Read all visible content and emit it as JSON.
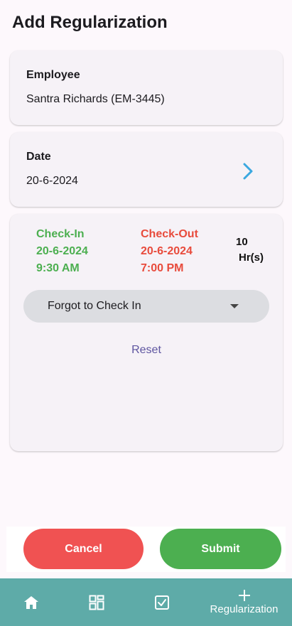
{
  "page": {
    "title": "Add Regularization"
  },
  "employee": {
    "label": "Employee",
    "value": "Santra Richards (EM-3445)"
  },
  "date": {
    "label": "Date",
    "value": "20-6-2024"
  },
  "check_in": {
    "label": "Check-In",
    "date": "20-6-2024",
    "time": "9:30 AM"
  },
  "check_out": {
    "label": "Check-Out",
    "date": "20-6-2024",
    "time": "7:00 PM"
  },
  "duration": {
    "value": "10",
    "unit": "Hr(s)"
  },
  "reason_dropdown": {
    "selected": "Forgot to Check In"
  },
  "reset": {
    "label": "Reset"
  },
  "actions": {
    "cancel": "Cancel",
    "submit": "Submit"
  },
  "nav": {
    "items": [
      {
        "icon": "home-icon"
      },
      {
        "icon": "dashboard-grid-icon"
      },
      {
        "icon": "checkbox-icon"
      },
      {
        "icon": "plus-icon",
        "label": "Regularization"
      }
    ]
  },
  "colors": {
    "check_in": "#4caf50",
    "check_out": "#e84b3c",
    "cancel": "#f05252",
    "submit": "#4caf50",
    "nav_bar": "#5eaba8",
    "chevron": "#3aa8e0",
    "reset_link": "#5e55a0"
  }
}
